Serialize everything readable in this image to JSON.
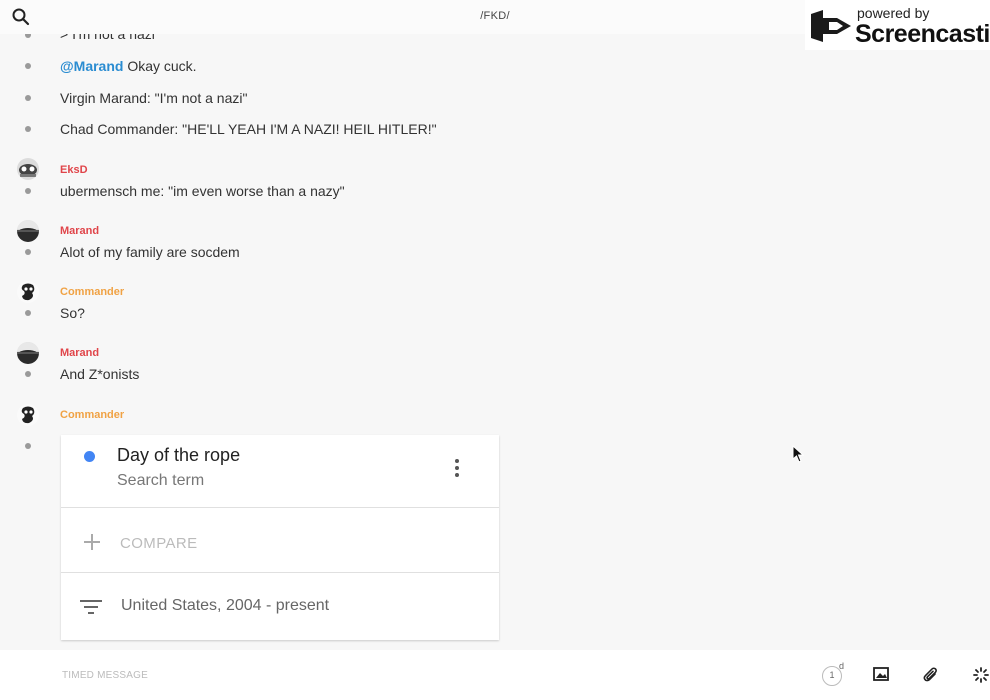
{
  "header": {
    "title": "/FKD/",
    "watermark_powered": "powered by",
    "watermark_brand": "Screencastify"
  },
  "messages": [
    {
      "text": "> I'm not a nazi"
    },
    {
      "mention": "@Marand",
      "text": " Okay cuck."
    },
    {
      "text": "Virgin Marand: \"I'm not a nazi\""
    },
    {
      "text": "Chad Commander: \"HE'LL YEAH I'M A NAZI! HEIL HITLER!\""
    },
    {
      "sender": "EksD",
      "text": "ubermensch me: \"im even worse than a nazy\""
    },
    {
      "sender": "Marand",
      "text": "Alot of my family are socdem"
    },
    {
      "sender": "Commander",
      "text": "So?"
    },
    {
      "sender": "Marand",
      "text": "And Z*onists"
    },
    {
      "sender": "Commander"
    }
  ],
  "card": {
    "term": "Day of the rope",
    "term_type": "Search term",
    "compare_label": "COMPARE",
    "filter_label": "United States, 2004 - present"
  },
  "composer": {
    "placeholder": "TIMED MESSAGE",
    "timer_value": "1",
    "timer_unit": "d"
  },
  "colors": {
    "sender_red": "#e0454a",
    "sender_orange": "#f0a244",
    "mention_blue": "#2a8cd1",
    "series_blue": "#4285f4"
  },
  "icons": [
    "search-icon",
    "screencastify-logo-icon",
    "phone-icon",
    "info-icon",
    "more-vert-icon",
    "plus-icon",
    "filter-icon",
    "timer-icon",
    "image-icon",
    "attachment-icon",
    "loading-icon"
  ]
}
